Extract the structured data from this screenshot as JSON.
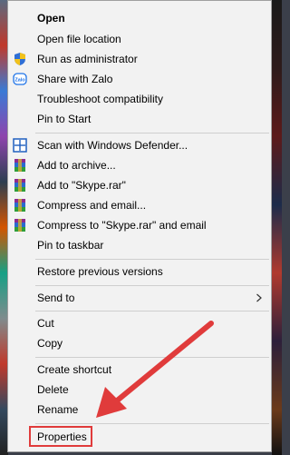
{
  "menu": {
    "items": [
      {
        "label": "Open",
        "bold": true,
        "icon": ""
      },
      {
        "label": "Open file location",
        "icon": ""
      },
      {
        "label": "Run as administrator",
        "icon": "uac-shield-icon"
      },
      {
        "label": "Share with Zalo",
        "icon": "zalo-icon"
      },
      {
        "label": "Troubleshoot compatibility",
        "icon": ""
      },
      {
        "label": "Pin to Start",
        "icon": ""
      },
      {
        "label": "Scan with Windows Defender...",
        "icon": "windows-defender-icon"
      },
      {
        "label": "Add to archive...",
        "icon": "winrar-icon"
      },
      {
        "label": "Add to \"Skype.rar\"",
        "icon": "winrar-icon"
      },
      {
        "label": "Compress and email...",
        "icon": "winrar-icon"
      },
      {
        "label": "Compress to \"Skype.rar\" and email",
        "icon": "winrar-icon"
      },
      {
        "label": "Pin to taskbar",
        "icon": ""
      },
      {
        "label": "Restore previous versions",
        "icon": ""
      },
      {
        "label": "Send to",
        "icon": "",
        "submenu": true
      },
      {
        "label": "Cut",
        "icon": ""
      },
      {
        "label": "Copy",
        "icon": ""
      },
      {
        "label": "Create shortcut",
        "icon": ""
      },
      {
        "label": "Delete",
        "icon": ""
      },
      {
        "label": "Rename",
        "icon": ""
      },
      {
        "label": "Properties",
        "icon": "",
        "highlighted": true
      }
    ]
  },
  "annotation": {
    "color": "#e03b3b"
  }
}
